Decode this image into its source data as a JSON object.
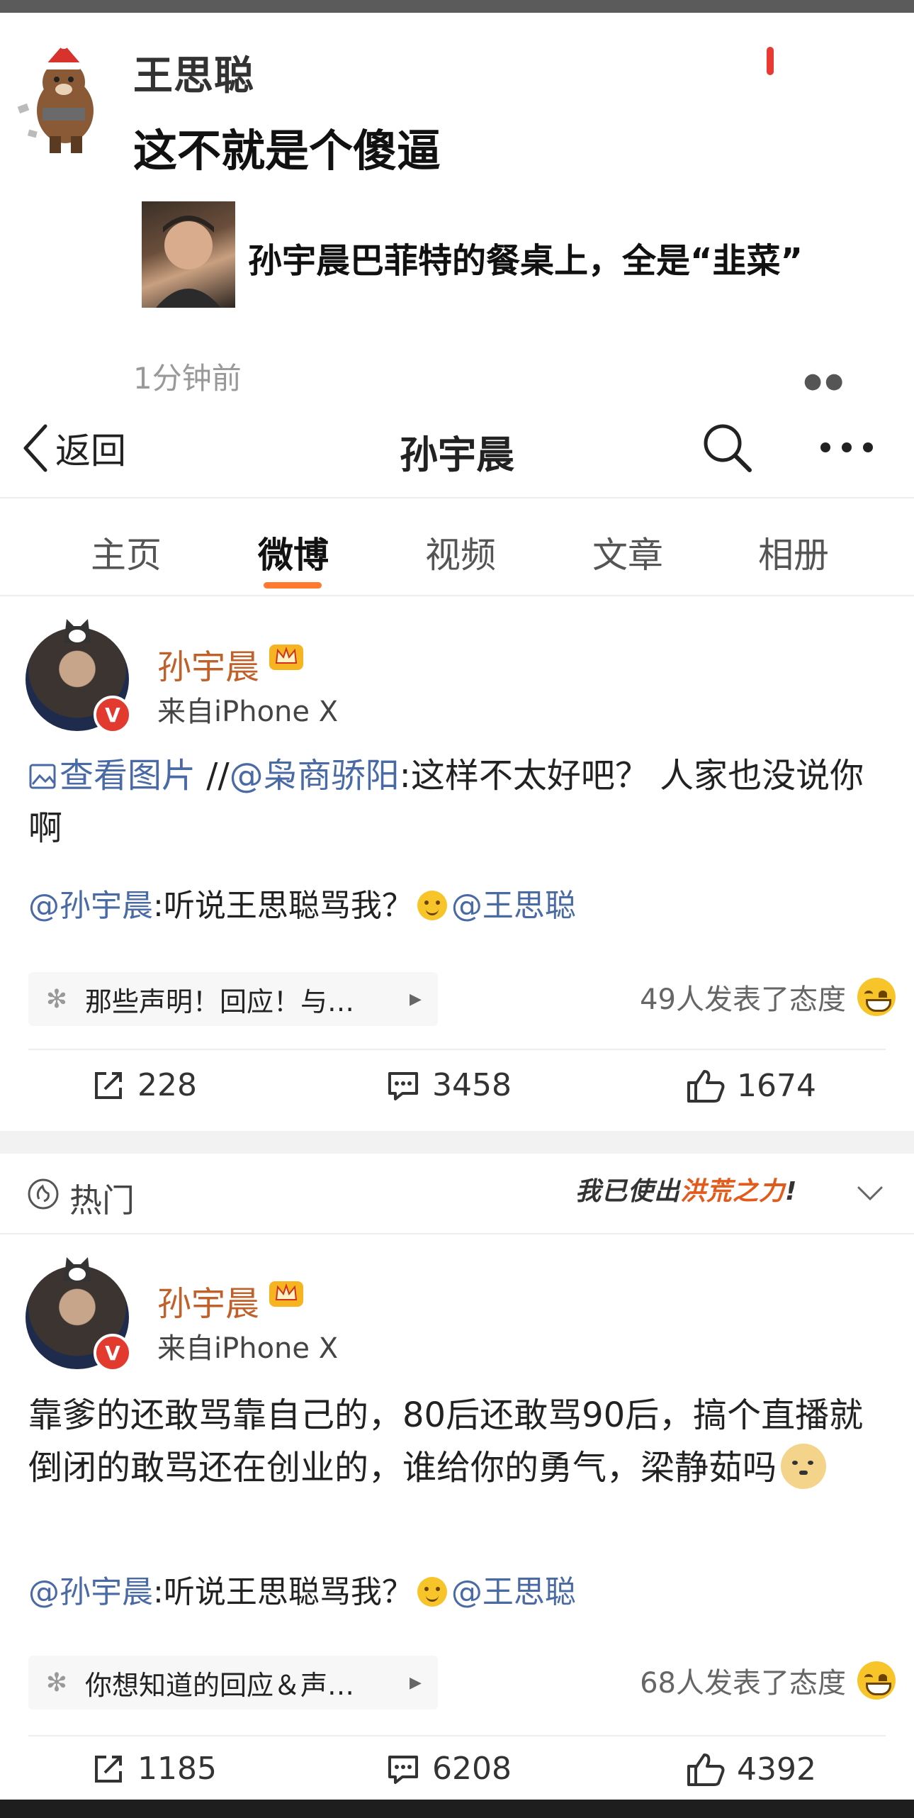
{
  "comment": {
    "name": "王思聪",
    "text": "这不就是个傻逼",
    "quoted_title": "孙宇晨巴菲特的餐桌上，全是“韭菜”",
    "time": "1分钟前"
  },
  "nav": {
    "back_label": "返回",
    "title": "孙宇晨"
  },
  "tabs": [
    {
      "label": "主页"
    },
    {
      "label": "微博"
    },
    {
      "label": "视频"
    },
    {
      "label": "文章"
    },
    {
      "label": "相册"
    }
  ],
  "active_tab": "微博",
  "posts": [
    {
      "author": "孙宇晨",
      "source": "来自iPhone X",
      "view_image": "查看图片",
      "forward_prefix": " //",
      "forward_user": "@枭商骄阳",
      "forward_text": ":这样不太好吧？ 人家也没说你啊",
      "retweet_user": "@孙宇晨",
      "retweet_text": ":听说王思聪骂我？",
      "retweet_mention": "@王思聪",
      "topic": "那些声明！回应！与…",
      "attitude": "49人发表了态度",
      "reposts": "228",
      "comments": "3458",
      "likes": "1674"
    },
    {
      "author": "孙宇晨",
      "source": "来自iPhone X",
      "body": "靠爹的还敢骂靠自己的，80后还敢骂90后，搞个直播就倒闭的敢骂还在创业的，谁给你的勇气，梁静茹吗",
      "retweet_user": "@孙宇晨",
      "retweet_text": ":听说王思聪骂我？",
      "retweet_mention": "@王思聪",
      "topic": "你想知道的回应＆声…",
      "attitude": "68人发表了态度",
      "reposts": "1185",
      "comments": "6208",
      "likes": "4392"
    }
  ],
  "hot": {
    "label": "热门",
    "sticker_a": "我已使出",
    "sticker_b": "洪荒之力",
    "sticker_c": "!"
  },
  "colors": {
    "accent": "#ff7a2e",
    "link": "#4a6aa6",
    "author": "#c0602a",
    "verified": "#e23a2e"
  }
}
